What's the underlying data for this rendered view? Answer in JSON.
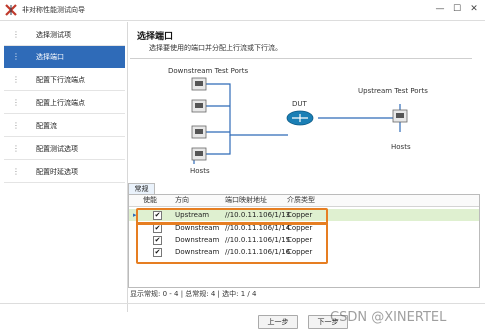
{
  "window": {
    "title": "非对称性能测试向导"
  },
  "sidebar": {
    "items": [
      {
        "label": "选择测试项"
      },
      {
        "label": "选择端口"
      },
      {
        "label": "配置下行流端点"
      },
      {
        "label": "配置上行流端点"
      },
      {
        "label": "配置流"
      },
      {
        "label": "配置测试选项"
      },
      {
        "label": "配置时延选项"
      }
    ],
    "active_index": 1
  },
  "header": {
    "title": "选择端口",
    "subtitle": "选择要使用的端口并分配上行流或下行流。"
  },
  "diagram": {
    "downstream_label": "Downstream Test Ports",
    "upstream_label": "Upstream Test Ports",
    "dut_label": "DUT",
    "hosts_left": "Hosts",
    "hosts_right": "Hosts"
  },
  "tab": {
    "label": "常规"
  },
  "table": {
    "headers": [
      "使能",
      "方向",
      "端口映射地址",
      "介质类型"
    ],
    "rows": [
      {
        "enabled": true,
        "direction": "Upstream",
        "address": "//10.0.11.106/1/13",
        "media": "Copper"
      },
      {
        "enabled": true,
        "direction": "Downstream",
        "address": "//10.0.11.106/1/14",
        "media": "Copper"
      },
      {
        "enabled": true,
        "direction": "Downstream",
        "address": "//10.0.11.106/1/15",
        "media": "Copper"
      },
      {
        "enabled": true,
        "direction": "Downstream",
        "address": "//10.0.11.106/1/16",
        "media": "Copper"
      }
    ],
    "check_glyph": "✔"
  },
  "status": "显示常规: 0 - 4 | 总常规: 4 | 选中: 1 / 4",
  "buttons": {
    "prev": "上一步",
    "next": "下一步"
  },
  "watermark": "CSDN @XINERTEL",
  "colors": {
    "active": "#2f6bb8",
    "highlight": "#e67e22",
    "selected_row": "#dff0d0",
    "router": "#1a7fb5"
  }
}
